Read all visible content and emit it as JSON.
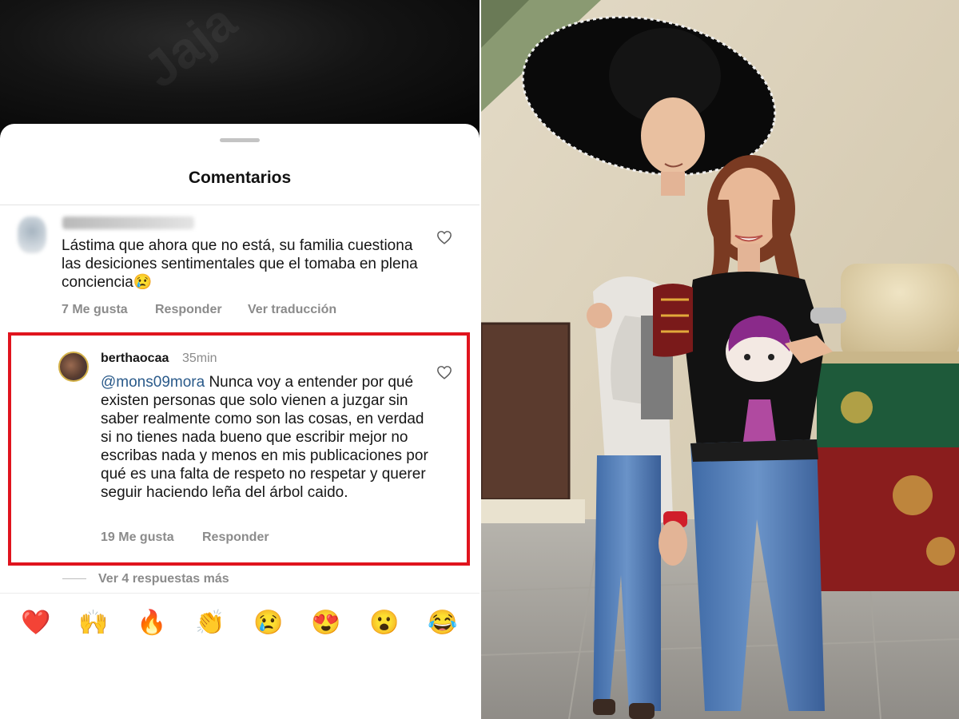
{
  "watermark": "Jaja",
  "sheet": {
    "title": "Comentarios"
  },
  "comments": [
    {
      "text": "Lástima que ahora que no está, su familia cuestiona las desiciones sentimentales que el tomaba en plena conciencia😢",
      "likes": "7 Me gusta",
      "reply": "Responder",
      "translate": "Ver traducción"
    },
    {
      "username": "berthaocaa",
      "time": "35min",
      "mention": "@mons09mora",
      "text": " Nunca voy a entender por qué existen personas que solo vienen a juzgar sin saber realmente como son las cosas, en verdad si no tienes nada bueno que escribir mejor no escribas nada y menos en mis publicaciones por qué es una falta de respeto no respetar y querer seguir haciendo leña del árbol caido.",
      "likes": "19 Me gusta",
      "reply": "Responder"
    }
  ],
  "more_replies": "Ver 4 respuestas más",
  "emoji_bar": [
    "❤️",
    "🙌",
    "🔥",
    "👏",
    "😢",
    "😍",
    "😮",
    "😂"
  ],
  "colors": {
    "highlight": "#e0141e",
    "mention": "#2a5a8a",
    "meta": "#8b8b8b"
  },
  "icons": {
    "like": "heart-outline-icon"
  }
}
